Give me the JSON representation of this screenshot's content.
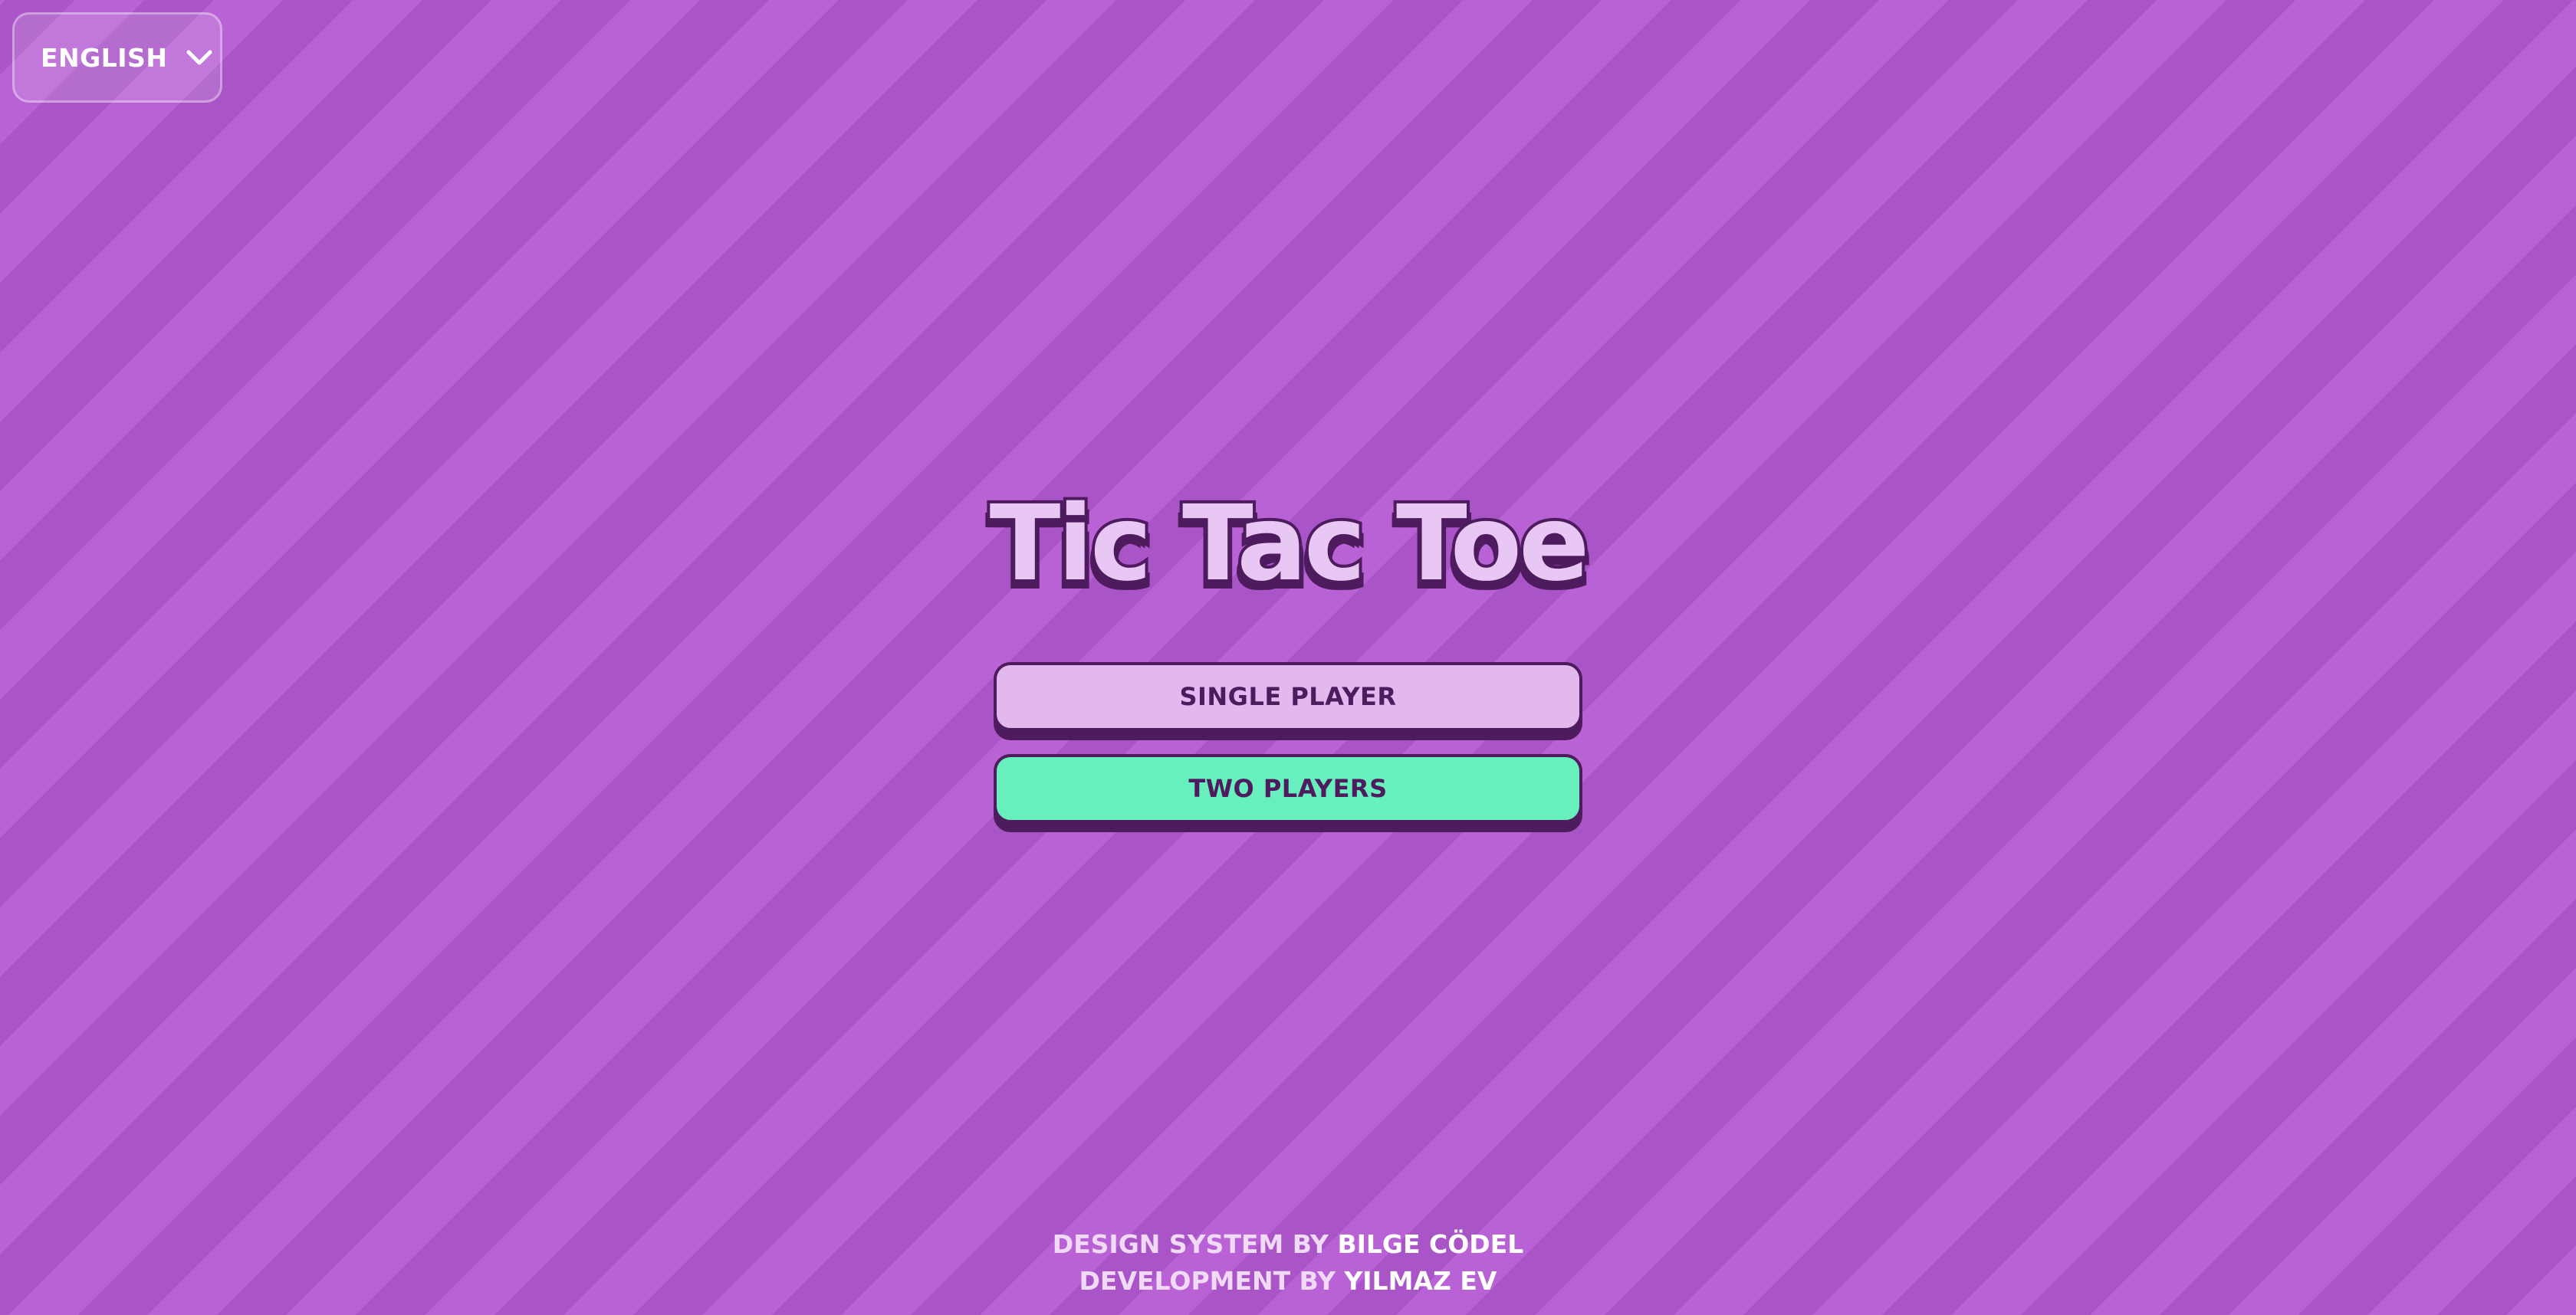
{
  "language_selector": {
    "label": "ENGLISH",
    "icon": "chevron-down-icon"
  },
  "title": "Tic Tac Toe",
  "menu": {
    "single_player_label": "SINGLE PLAYER",
    "two_players_label": "TWO PLAYERS"
  },
  "credits": {
    "design_prefix": "DESIGN SYSTEM BY",
    "design_name": "BILGE CÖDEL",
    "dev_prefix": "DEVELOPMENT BY",
    "dev_name": "YILMAZ EV"
  },
  "colors": {
    "background": "#b760d4",
    "background_stripe": "#a954c7",
    "outline": "#4e1b5e",
    "single_player_button": "#e2b8ee",
    "two_players_button": "#67efbd",
    "title_fill": "#e9c7f4"
  }
}
